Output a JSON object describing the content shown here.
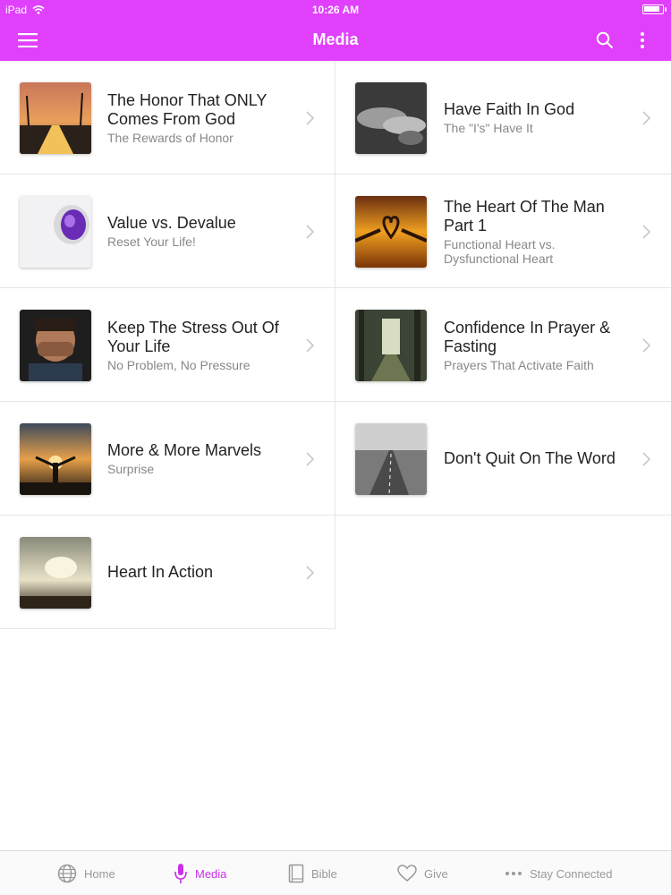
{
  "status": {
    "device": "iPad",
    "time": "10:26 AM",
    "battery_level": 0.9
  },
  "nav": {
    "title": "Media"
  },
  "colors": {
    "brand": "#e040fb",
    "active_tab": "#c930e8"
  },
  "items": [
    {
      "title": "The Honor That ONLY Comes From God",
      "subtitle": "The Rewards of Honor"
    },
    {
      "title": "Have Faith In God",
      "subtitle": "The \"I's\" Have It"
    },
    {
      "title": "Value vs. Devalue",
      "subtitle": "Reset Your Life!"
    },
    {
      "title": "The Heart Of The Man Part 1",
      "subtitle": "Functional Heart vs. Dysfunctional Heart"
    },
    {
      "title": "Keep The Stress Out Of Your Life",
      "subtitle": "No Problem, No Pressure"
    },
    {
      "title": "Confidence In Prayer & Fasting",
      "subtitle": "Prayers That Activate Faith"
    },
    {
      "title": "More & More Marvels",
      "subtitle": "Surprise"
    },
    {
      "title": "Don't Quit On The Word",
      "subtitle": ""
    },
    {
      "title": "Heart In Action",
      "subtitle": ""
    }
  ],
  "tabs": [
    {
      "label": "Home",
      "icon": "globe-icon",
      "active": false
    },
    {
      "label": "Media",
      "icon": "microphone-icon",
      "active": true
    },
    {
      "label": "Bible",
      "icon": "book-icon",
      "active": false
    },
    {
      "label": "Give",
      "icon": "heart-icon",
      "active": false
    },
    {
      "label": "Stay Connected",
      "icon": "more-dots-icon",
      "active": false
    }
  ]
}
